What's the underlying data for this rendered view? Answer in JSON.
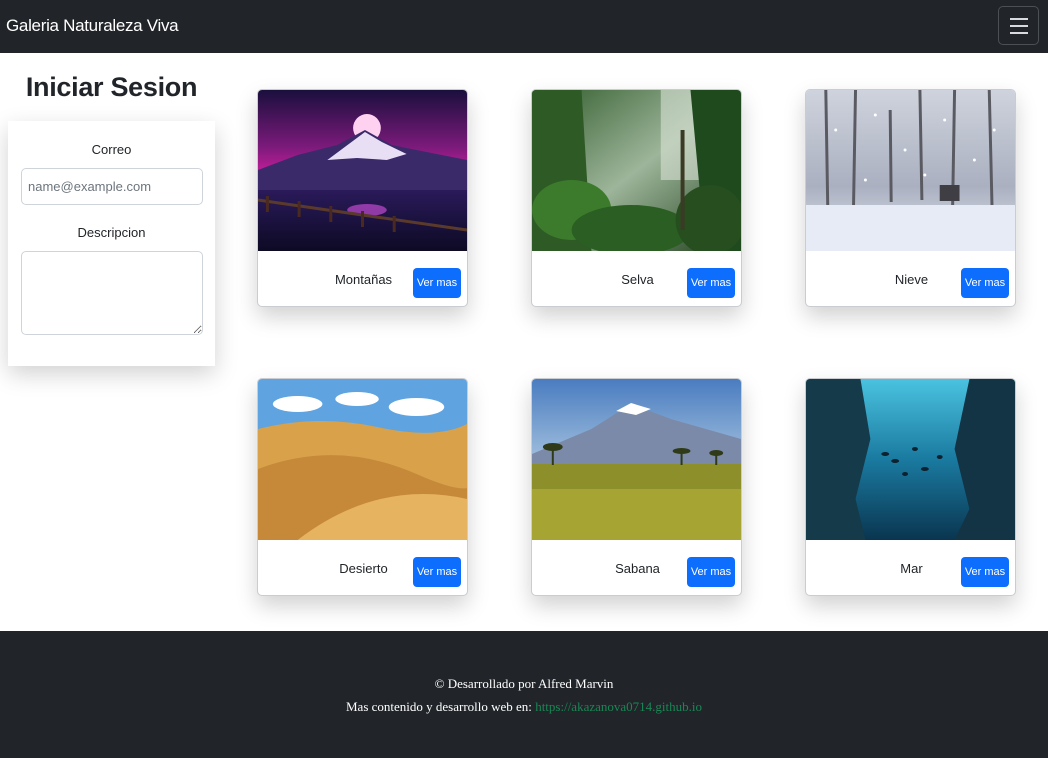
{
  "navbar": {
    "brand": "Galeria Naturaleza Viva",
    "toggler_icon": "hamburger-icon"
  },
  "login": {
    "title": "Iniciar Sesion",
    "email_label": "Correo",
    "email_placeholder": "name@example.com",
    "description_label": "Descripcion"
  },
  "gallery": {
    "cards": [
      {
        "title": "Montañas",
        "button": "Ver mas"
      },
      {
        "title": "Selva",
        "button": "Ver mas"
      },
      {
        "title": "Nieve",
        "button": "Ver mas"
      },
      {
        "title": "Desierto",
        "button": "Ver mas"
      },
      {
        "title": "Sabana",
        "button": "Ver mas"
      },
      {
        "title": "Mar",
        "button": "Ver mas"
      }
    ]
  },
  "footer": {
    "credit": "© Desarrollado por Alfred Marvin",
    "more_text": "Mas contenido y desarrollo web en:",
    "link": "https://akazanova0714.github.io"
  },
  "colors": {
    "navbar": "#212529",
    "primary_button": "#0d6efd",
    "footer_link": "#198754"
  }
}
